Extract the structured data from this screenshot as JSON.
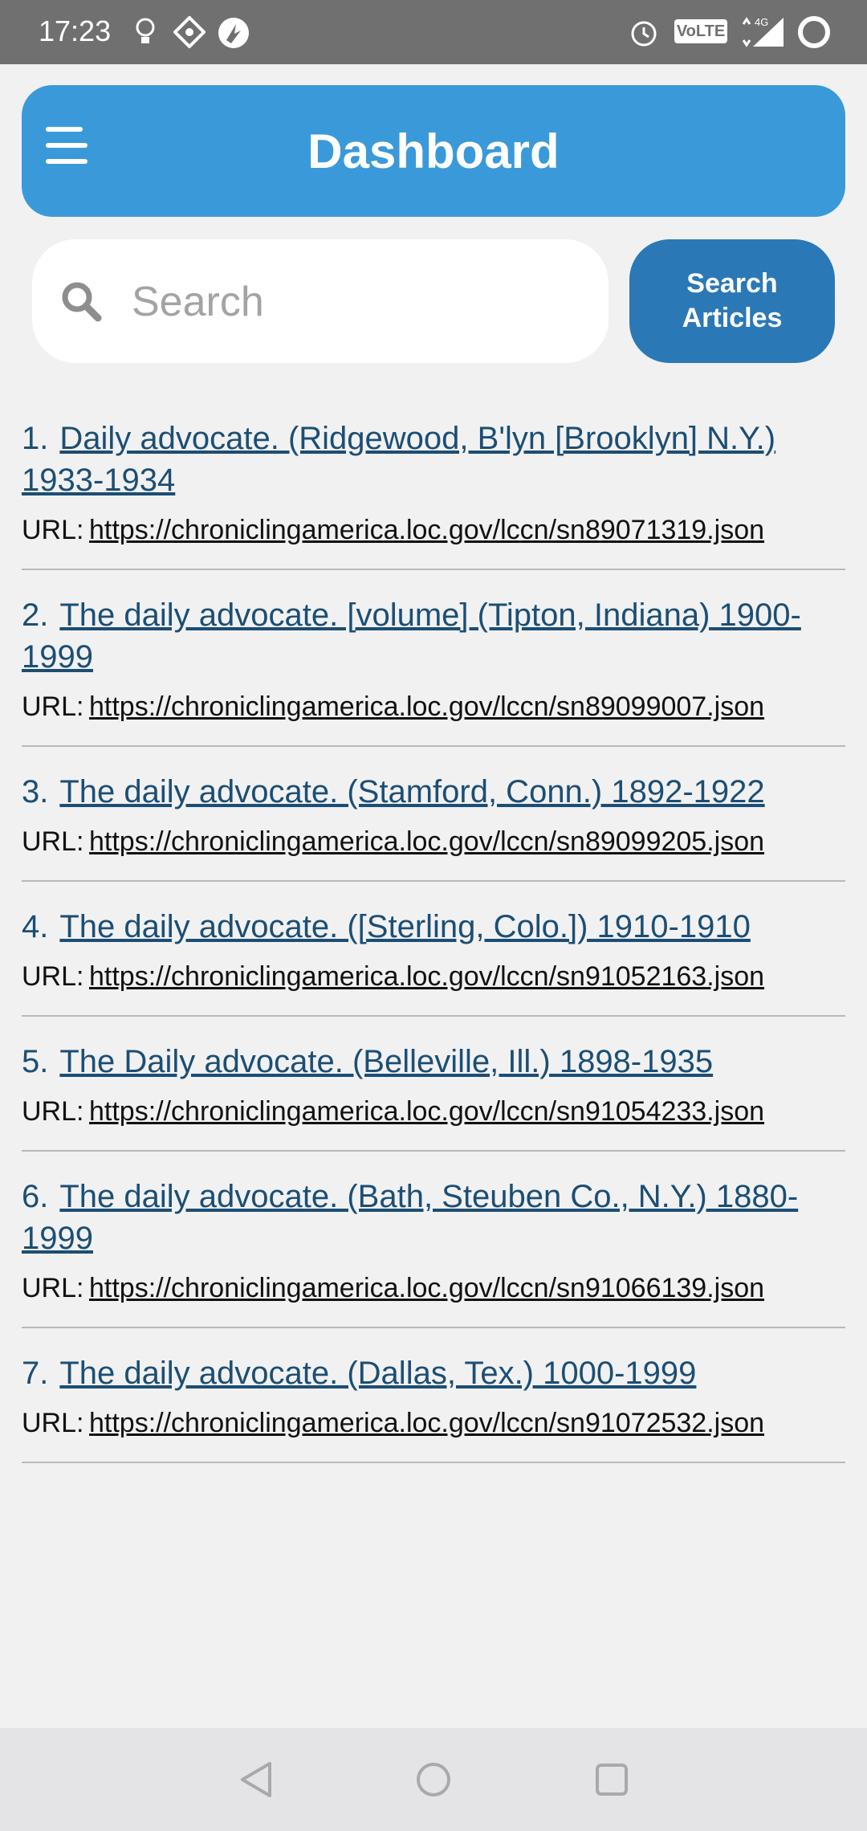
{
  "status_bar": {
    "time": "17:23",
    "icons": [
      "bulb-icon",
      "dots-icon",
      "app-icon",
      "alarm-icon",
      "volte-icon",
      "signal-4g-icon",
      "battery-ring-icon"
    ],
    "volte_label": "VoLTE",
    "network_label": "4G"
  },
  "header": {
    "title": "Dashboard",
    "menu_icon": "hamburger-menu-icon"
  },
  "search": {
    "placeholder": "Search",
    "value": "",
    "button_label_line1": "Search",
    "button_label_line2": "Articles"
  },
  "results": [
    {
      "num": "1.",
      "title": "Daily advocate. (Ridgewood, B'lyn [Brooklyn] N.Y.) 1933-1934",
      "url_label": "URL:",
      "url": "https://chroniclingamerica.loc.gov/lccn/sn89071319.json"
    },
    {
      "num": "2.",
      "title": "The daily advocate. [volume] (Tipton, Indiana) 1900-1999",
      "url_label": "URL:",
      "url": "https://chroniclingamerica.loc.gov/lccn/sn89099007.json"
    },
    {
      "num": "3.",
      "title": "The daily advocate. (Stamford, Conn.) 1892-1922",
      "url_label": "URL:",
      "url": "https://chroniclingamerica.loc.gov/lccn/sn89099205.json"
    },
    {
      "num": "4.",
      "title": "The daily advocate. ([Sterling, Colo.]) 1910-1910",
      "url_label": "URL:",
      "url": "https://chroniclingamerica.loc.gov/lccn/sn91052163.json"
    },
    {
      "num": "5.",
      "title": "The Daily advocate. (Belleville, Ill.) 1898-1935",
      "url_label": "URL:",
      "url": "https://chroniclingamerica.loc.gov/lccn/sn91054233.json"
    },
    {
      "num": "6.",
      "title": "The daily advocate. (Bath, Steuben Co., N.Y.) 1880-1999",
      "url_label": "URL:",
      "url": "https://chroniclingamerica.loc.gov/lccn/sn91066139.json"
    },
    {
      "num": "7.",
      "title": "The daily advocate. (Dallas, Tex.) 1000-1999",
      "url_label": "URL:",
      "url": "https://chroniclingamerica.loc.gov/lccn/sn91072532.json"
    }
  ],
  "nav_bar": {
    "buttons": [
      "back-icon",
      "home-icon",
      "recents-icon"
    ]
  },
  "colors": {
    "header": "#3a9ad9",
    "search_button": "#2b78b6",
    "link": "#1c4e74",
    "background": "#f1f1f2"
  }
}
